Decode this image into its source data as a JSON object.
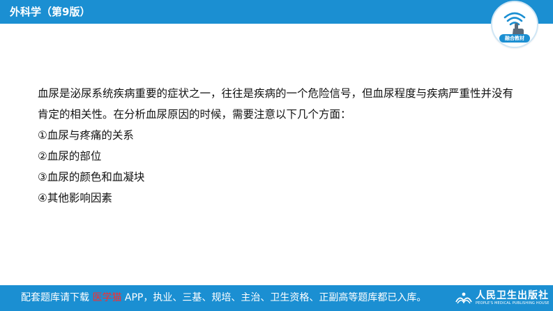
{
  "header": {
    "title": "外科学（第9版）",
    "badge_label": "融合教材"
  },
  "content": {
    "paragraph": "血尿是泌尿系统疾病重要的症状之一，往往是疾病的一个危险信号，但血尿程度与疾病严重性并没有肯定的相关性。在分析血尿原因的时候，需要注意以下几个方面：",
    "items": [
      "①血尿与疼痛的关系",
      "②血尿的部位",
      "③血尿的颜色和血凝块",
      "④其他影响因素"
    ]
  },
  "footer": {
    "text_before": "配套题库请下载",
    "highlight": "医学猫",
    "text_after": "APP，执业、三基、规培、主治、卫生资格、正副高等题库都已入库。",
    "highlight_color": "#ff2a2a",
    "publisher_name": "人民卫生出版社",
    "publisher_en": "PEOPLE'S MEDICAL PUBLISHING HOUSE"
  },
  "colors": {
    "brand_blue": "#1b8fd2"
  },
  "icons": {
    "badge": "hand-touch-wifi-icon",
    "publisher_logo": "publisher-book-icon"
  }
}
